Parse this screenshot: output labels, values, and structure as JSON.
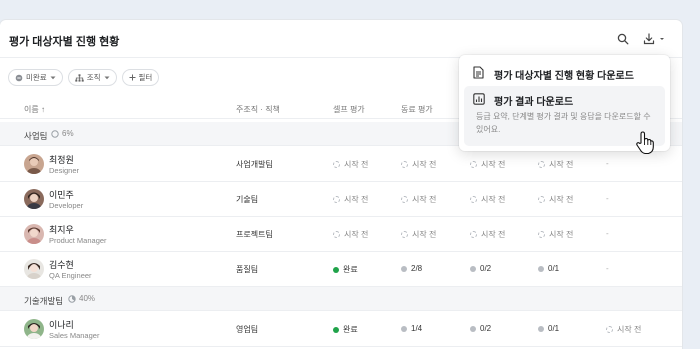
{
  "header": {
    "title": "평가 대상자별 진행 현황"
  },
  "filters": [
    {
      "label": "미완료"
    },
    {
      "label": "조직"
    },
    {
      "label": "필터"
    }
  ],
  "columns": {
    "name": "이름 ↑",
    "org": "주조직 · 직책",
    "self": "셀프 평가",
    "peer": "동료 평가"
  },
  "groups": [
    {
      "name": "사업팀",
      "pct": "6%"
    },
    {
      "name": "기술개발팀",
      "pct": "40%"
    }
  ],
  "rows": [
    {
      "name": "최정원",
      "role": "Designer",
      "org": "사업개발팀",
      "c1": "시작 전",
      "c2": "시작 전",
      "c3": "시작 전",
      "c4": "시작 전",
      "c5": "-"
    },
    {
      "name": "이민주",
      "role": "Developer",
      "org": "기술팀",
      "c1": "시작 전",
      "c2": "시작 전",
      "c3": "시작 전",
      "c4": "시작 전",
      "c5": "-"
    },
    {
      "name": "최지우",
      "role": "Product Manager",
      "org": "프로젝트팀",
      "c1": "시작 전",
      "c2": "시작 전",
      "c3": "시작 전",
      "c4": "시작 전",
      "c5": "-"
    },
    {
      "name": "김수현",
      "role": "QA Engineer",
      "org": "품질팀",
      "c1": "완료",
      "c2": "2/8",
      "c3": "0/2",
      "c4": "0/1",
      "c5": "-"
    },
    {
      "name": "이나리",
      "role": "Sales Manager",
      "org": "영업팀",
      "c1": "완료",
      "c2": "1/4",
      "c3": "0/2",
      "c4": "0/1",
      "c5": "시작 전"
    }
  ],
  "dropdown": {
    "item1": "평가 대상자별 진행 현황 다운로드",
    "item2": "평가 결과 다운로드",
    "item2_desc": "등급 요약, 단계별 평가 결과 및 응답을 다운로드할 수 있어요."
  },
  "colors": {
    "done": "#20a34a",
    "accent": "#1d1f22",
    "muted": "#888888"
  },
  "icons": [
    "search-icon",
    "download-icon",
    "document-icon",
    "chart-icon",
    "hand-cursor-icon"
  ]
}
